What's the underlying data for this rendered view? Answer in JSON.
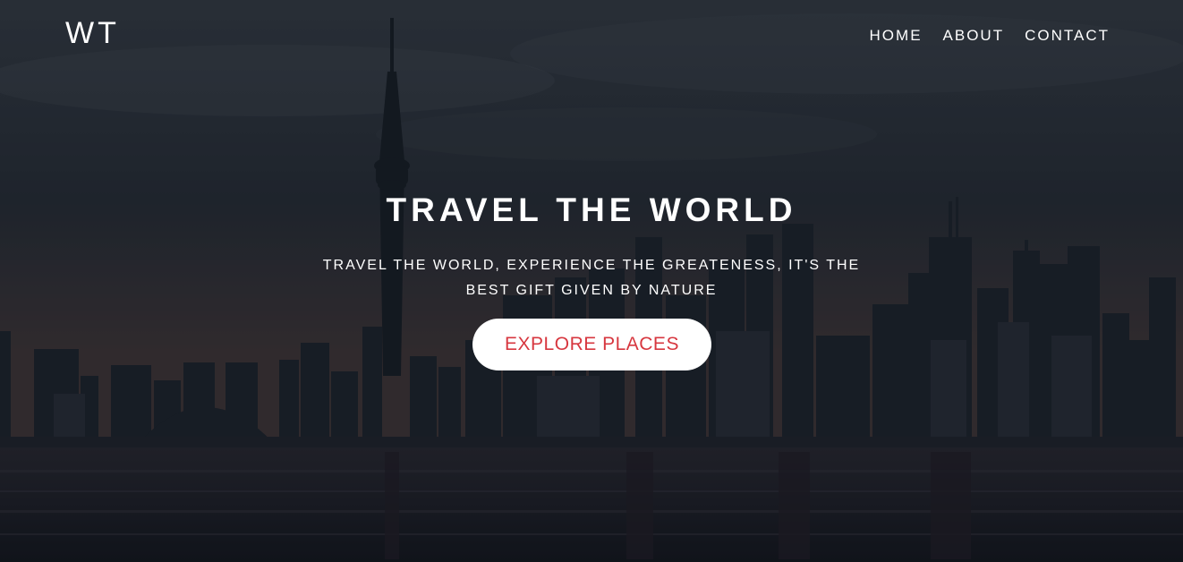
{
  "brand": {
    "logo_text": "WT"
  },
  "nav": {
    "items": [
      {
        "label": "HOME"
      },
      {
        "label": "ABOUT"
      },
      {
        "label": "CONTACT"
      }
    ]
  },
  "hero": {
    "title": "TRAVEL THE WORLD",
    "subtitle": "TRAVEL THE WORLD, EXPERIENCE THE GREATENESS, IT'S THE BEST GIFT GIVEN BY NATURE",
    "cta_label": "EXPLORE PLACES",
    "background_image": "city-skyline-waterfront"
  },
  "colors": {
    "cta_text": "#d7373f",
    "cta_background": "#ffffff",
    "text": "#ffffff",
    "overlay": "#0a0e16"
  }
}
